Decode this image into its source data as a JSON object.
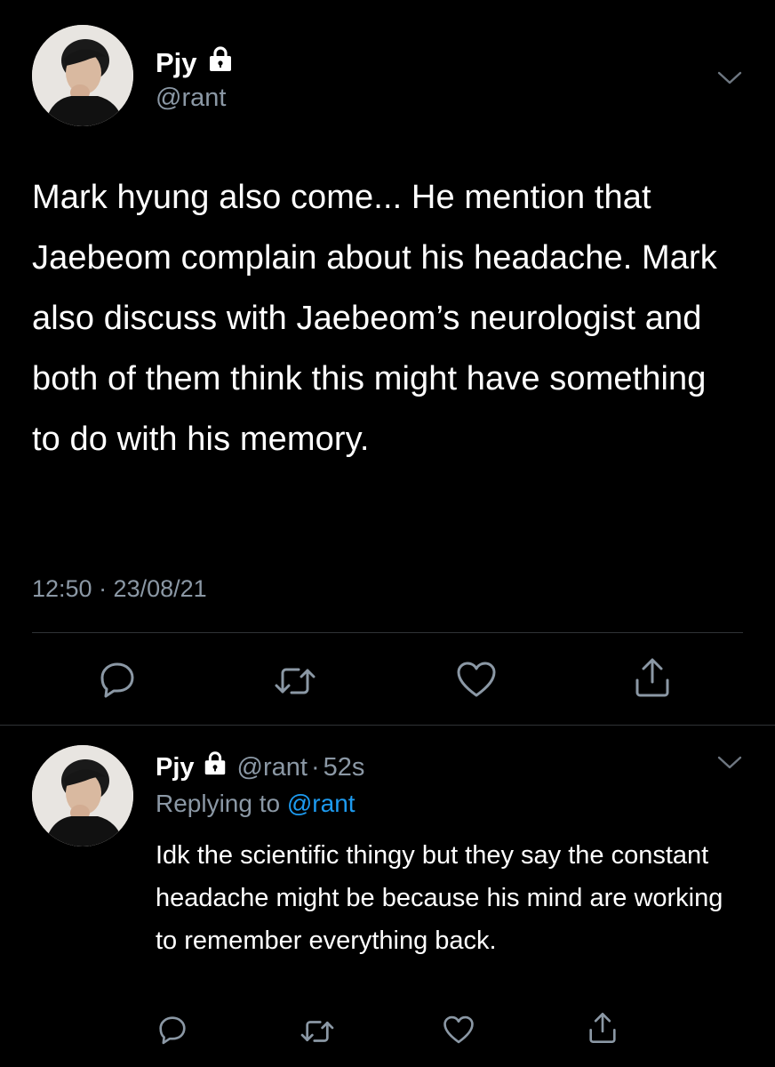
{
  "main_tweet": {
    "display_name": "Pjy",
    "handle": "@rant",
    "text": "Mark hyung also come... He mention that Jaebeom complain about his headache. Mark also discuss with Jaebeom’s neurologist and both of them think this might have something to do with his memory.",
    "timestamp": "12:50 · 23/08/21",
    "actions": [
      "reply-icon",
      "retweet-icon",
      "like-icon",
      "share-icon"
    ]
  },
  "reply_tweet": {
    "display_name": "Pjy",
    "handle": "@rant",
    "separator": "·",
    "time_ago": "52s",
    "replying_prefix": "Replying to",
    "replying_to": "@rant",
    "text": "Idk the scientific thingy but they say the constant headache might be because his mind are working to remember everything back.",
    "actions": [
      "reply-icon",
      "retweet-icon",
      "like-icon",
      "share-icon"
    ]
  },
  "colors": {
    "background": "#000000",
    "text_primary": "#ffffff",
    "text_secondary": "#8b98a5",
    "accent": "#1d9bf0",
    "divider": "#2f3336"
  }
}
